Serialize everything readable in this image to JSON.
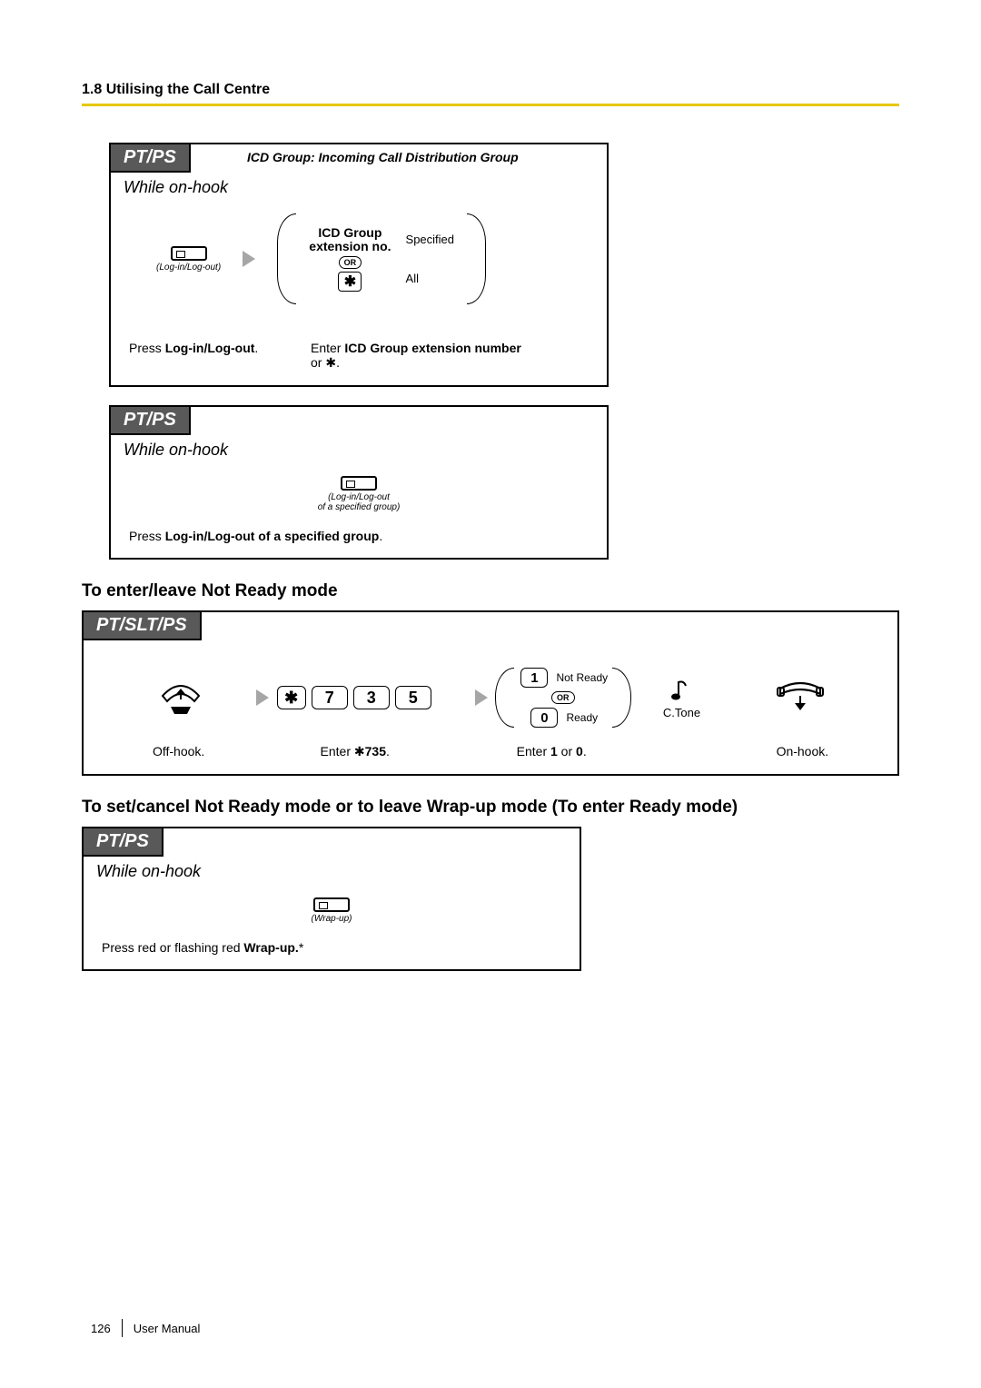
{
  "header": {
    "title": "1.8 Utilising the Call Centre"
  },
  "box1": {
    "tab": "PT/PS",
    "top_note": "ICD Group: Incoming Call Distribution Group",
    "subhead": "While on-hook",
    "key_label": "(Log-in/Log-out)",
    "paren": {
      "title_line1": "ICD Group",
      "title_line2": "extension no.",
      "right1": "Specified",
      "or": "OR",
      "right2": "All"
    },
    "caption_left_pre": "Press ",
    "caption_left_bold": "Log-in/Log-out",
    "caption_left_post": ".",
    "caption_right_pre": "Enter ",
    "caption_right_bold": "ICD Group extension number",
    "caption_right_line2_pre": "or ",
    "caption_right_line2_post": "."
  },
  "box2": {
    "tab": "PT/PS",
    "subhead": "While on-hook",
    "key_label1": "(Log-in/Log-out",
    "key_label2": "of a specified group)",
    "caption_pre": "Press ",
    "caption_bold": "Log-in/Log-out of a specified group",
    "caption_post": "."
  },
  "section2_title": "To enter/leave Not Ready mode",
  "box3": {
    "tab": "PT/SLT/PS",
    "digits": {
      "star": "✱",
      "d1": "7",
      "d2": "3",
      "d3": "5"
    },
    "opt": {
      "one": "1",
      "not_ready": "Not Ready",
      "or": "OR",
      "zero": "0",
      "ready": "Ready"
    },
    "ctone": "C.Tone",
    "captions": {
      "c1": "Off-hook.",
      "c2_pre": "Enter ",
      "c2_bold": "735",
      "c2_post": ".",
      "c3_pre": "Enter ",
      "c3_b1": "1",
      "c3_mid": " or ",
      "c3_b2": "0",
      "c3_post": ".",
      "c4": "On-hook."
    }
  },
  "section3_title": "To set/cancel Not Ready mode or to leave Wrap-up mode (To enter Ready mode)",
  "box4": {
    "tab": "PT/PS",
    "subhead": "While on-hook",
    "key_label": "(Wrap-up)",
    "caption_pre": "Press red or flashing red ",
    "caption_bold": "Wrap-up.",
    "caption_post": "*"
  },
  "footer": {
    "page": "126",
    "manual": "User Manual"
  },
  "glyphs": {
    "star": "✱"
  }
}
